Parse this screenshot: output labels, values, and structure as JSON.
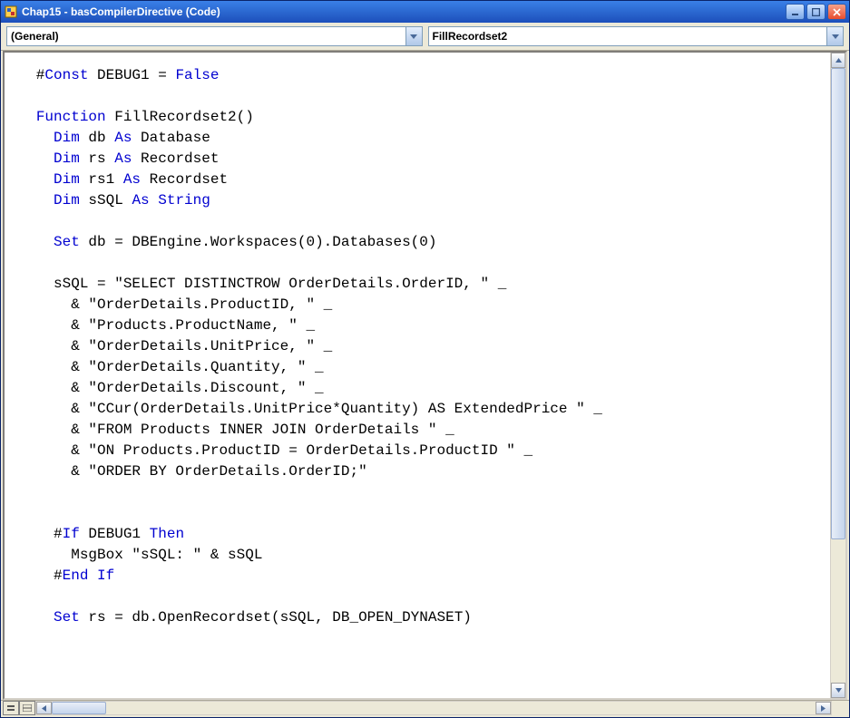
{
  "titlebar": {
    "title": "Chap15 - basCompilerDirective (Code)"
  },
  "dropdowns": {
    "left": "(General)",
    "right": "FillRecordset2"
  },
  "code": {
    "lines": [
      {
        "indent": "   ",
        "segs": [
          {
            "t": "#"
          },
          {
            "t": "Const ",
            "c": "kw"
          },
          {
            "t": "DEBUG1 = "
          },
          {
            "t": "False",
            "c": "kw"
          }
        ]
      },
      {
        "indent": "",
        "segs": [
          {
            "t": ""
          }
        ]
      },
      {
        "indent": "   ",
        "segs": [
          {
            "t": "Function ",
            "c": "kw"
          },
          {
            "t": "FillRecordset2()"
          }
        ]
      },
      {
        "indent": "     ",
        "segs": [
          {
            "t": "Dim ",
            "c": "kw"
          },
          {
            "t": "db "
          },
          {
            "t": "As ",
            "c": "kw"
          },
          {
            "t": "Database"
          }
        ]
      },
      {
        "indent": "     ",
        "segs": [
          {
            "t": "Dim ",
            "c": "kw"
          },
          {
            "t": "rs "
          },
          {
            "t": "As ",
            "c": "kw"
          },
          {
            "t": "Recordset"
          }
        ]
      },
      {
        "indent": "     ",
        "segs": [
          {
            "t": "Dim ",
            "c": "kw"
          },
          {
            "t": "rs1 "
          },
          {
            "t": "As ",
            "c": "kw"
          },
          {
            "t": "Recordset"
          }
        ]
      },
      {
        "indent": "     ",
        "segs": [
          {
            "t": "Dim ",
            "c": "kw"
          },
          {
            "t": "sSQL "
          },
          {
            "t": "As String",
            "c": "kw"
          }
        ]
      },
      {
        "indent": "",
        "segs": [
          {
            "t": ""
          }
        ]
      },
      {
        "indent": "     ",
        "segs": [
          {
            "t": "Set ",
            "c": "kw"
          },
          {
            "t": "db = DBEngine.Workspaces(0).Databases(0)"
          }
        ]
      },
      {
        "indent": "",
        "segs": [
          {
            "t": ""
          }
        ]
      },
      {
        "indent": "     ",
        "segs": [
          {
            "t": "sSQL = \"SELECT DISTINCTROW OrderDetails.OrderID, \" _"
          }
        ]
      },
      {
        "indent": "       ",
        "segs": [
          {
            "t": "& \"OrderDetails.ProductID, \" _"
          }
        ]
      },
      {
        "indent": "       ",
        "segs": [
          {
            "t": "& \"Products.ProductName, \" _"
          }
        ]
      },
      {
        "indent": "       ",
        "segs": [
          {
            "t": "& \"OrderDetails.UnitPrice, \" _"
          }
        ]
      },
      {
        "indent": "       ",
        "segs": [
          {
            "t": "& \"OrderDetails.Quantity, \" _"
          }
        ]
      },
      {
        "indent": "       ",
        "segs": [
          {
            "t": "& \"OrderDetails.Discount, \" _"
          }
        ]
      },
      {
        "indent": "       ",
        "segs": [
          {
            "t": "& \"CCur(OrderDetails.UnitPrice*Quantity) AS ExtendedPrice \" _"
          }
        ]
      },
      {
        "indent": "       ",
        "segs": [
          {
            "t": "& \"FROM Products INNER JOIN OrderDetails \" _"
          }
        ]
      },
      {
        "indent": "       ",
        "segs": [
          {
            "t": "& \"ON Products.ProductID = OrderDetails.ProductID \" _"
          }
        ]
      },
      {
        "indent": "       ",
        "segs": [
          {
            "t": "& \"ORDER BY OrderDetails.OrderID;\""
          }
        ]
      },
      {
        "indent": "",
        "segs": [
          {
            "t": ""
          }
        ]
      },
      {
        "indent": "",
        "segs": [
          {
            "t": ""
          }
        ]
      },
      {
        "indent": "     ",
        "segs": [
          {
            "t": "#"
          },
          {
            "t": "If ",
            "c": "kw"
          },
          {
            "t": "DEBUG1 "
          },
          {
            "t": "Then",
            "c": "kw"
          }
        ]
      },
      {
        "indent": "       ",
        "segs": [
          {
            "t": "MsgBox \"sSQL: \" & sSQL"
          }
        ]
      },
      {
        "indent": "     ",
        "segs": [
          {
            "t": "#"
          },
          {
            "t": "End If",
            "c": "kw"
          }
        ]
      },
      {
        "indent": "",
        "segs": [
          {
            "t": ""
          }
        ]
      },
      {
        "indent": "     ",
        "segs": [
          {
            "t": "Set ",
            "c": "kw"
          },
          {
            "t": "rs = db.OpenRecordset(sSQL, DB_OPEN_DYNASET)"
          }
        ]
      }
    ]
  }
}
